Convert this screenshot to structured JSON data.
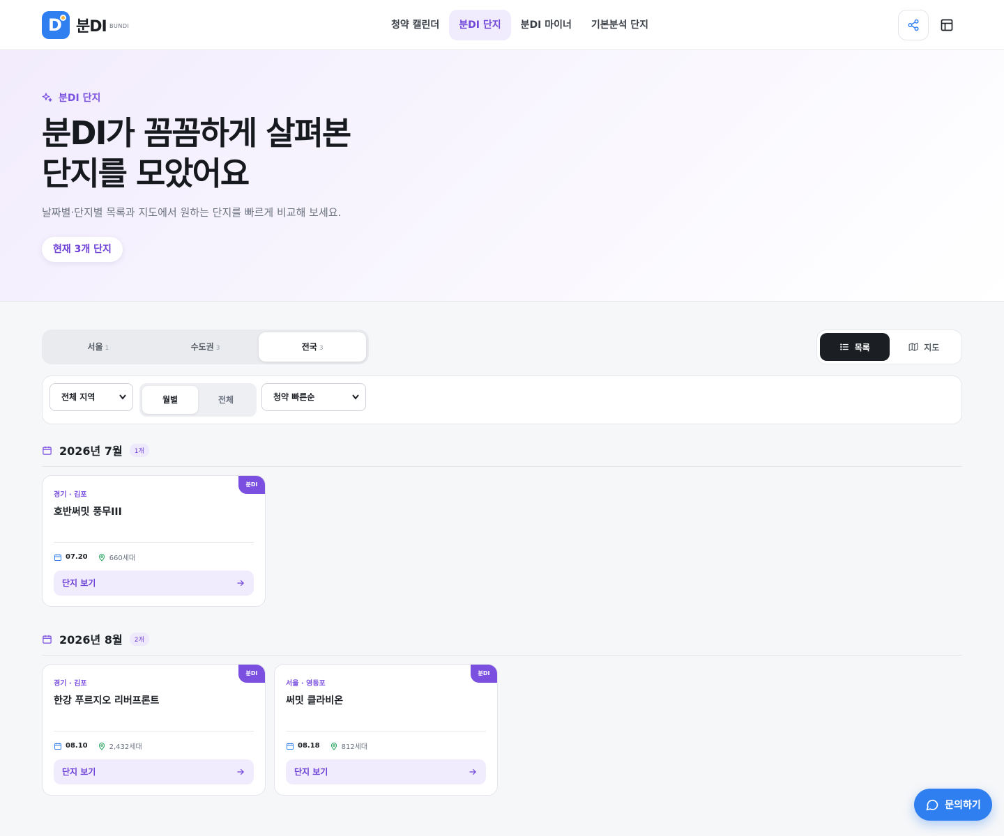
{
  "header": {
    "brand": "분DI",
    "brand_sub": "BUNDI",
    "nav": [
      {
        "label": "청약 캘린더"
      },
      {
        "label": "분DI 단지"
      },
      {
        "label": "분DI 마이너"
      },
      {
        "label": "기본분석 단지"
      }
    ],
    "active_nav": "분DI 단지",
    "icons": [
      "share-icon",
      "layout-icon"
    ]
  },
  "hero": {
    "tag": "분DI 단지",
    "title_line1": "분DI가 꼼꼼하게 살펴본",
    "title_line2": "단지를 모았어요",
    "description": "날짜별·단지별 목록과 지도에서 원하는 단지를 빠르게 비교해 보세요.",
    "pill": "현재 3개 단지"
  },
  "region_tabs": [
    {
      "label": "서울",
      "count": "1"
    },
    {
      "label": "수도권",
      "count": "3"
    },
    {
      "label": "전국",
      "count": "3"
    }
  ],
  "active_region": "전국",
  "view_toggle": {
    "list_label": "목록",
    "map_label": "지도",
    "active": "목록"
  },
  "filters": {
    "region_select": "전체 지역",
    "period_options": [
      "월별",
      "전체"
    ],
    "active_period": "월별",
    "sort_select": "청약 빠른순"
  },
  "groups": [
    {
      "title": "2026년 7월",
      "badge": "1개",
      "cards": [
        {
          "ribbon": "분DI",
          "location": "경기 · 김포",
          "name": "호반써밋 풍무III",
          "date": "07.20",
          "units": "660세대",
          "button": "단지 보기"
        }
      ]
    },
    {
      "title": "2026년 8월",
      "badge": "2개",
      "cards": [
        {
          "ribbon": "분DI",
          "location": "경기 · 김포",
          "name": "한강 푸르지오 리버프론트",
          "date": "08.10",
          "units": "2,432세대",
          "button": "단지 보기"
        },
        {
          "ribbon": "분DI",
          "location": "서울 · 영등포",
          "name": "써밋 클라비온",
          "date": "08.18",
          "units": "812세대",
          "button": "단지 보기"
        }
      ]
    }
  ],
  "fab": {
    "label": "문의하기"
  },
  "colors": {
    "accent": "#7b4fe0",
    "brand_blue": "#2f7ff0",
    "dark": "#1b1f24"
  }
}
